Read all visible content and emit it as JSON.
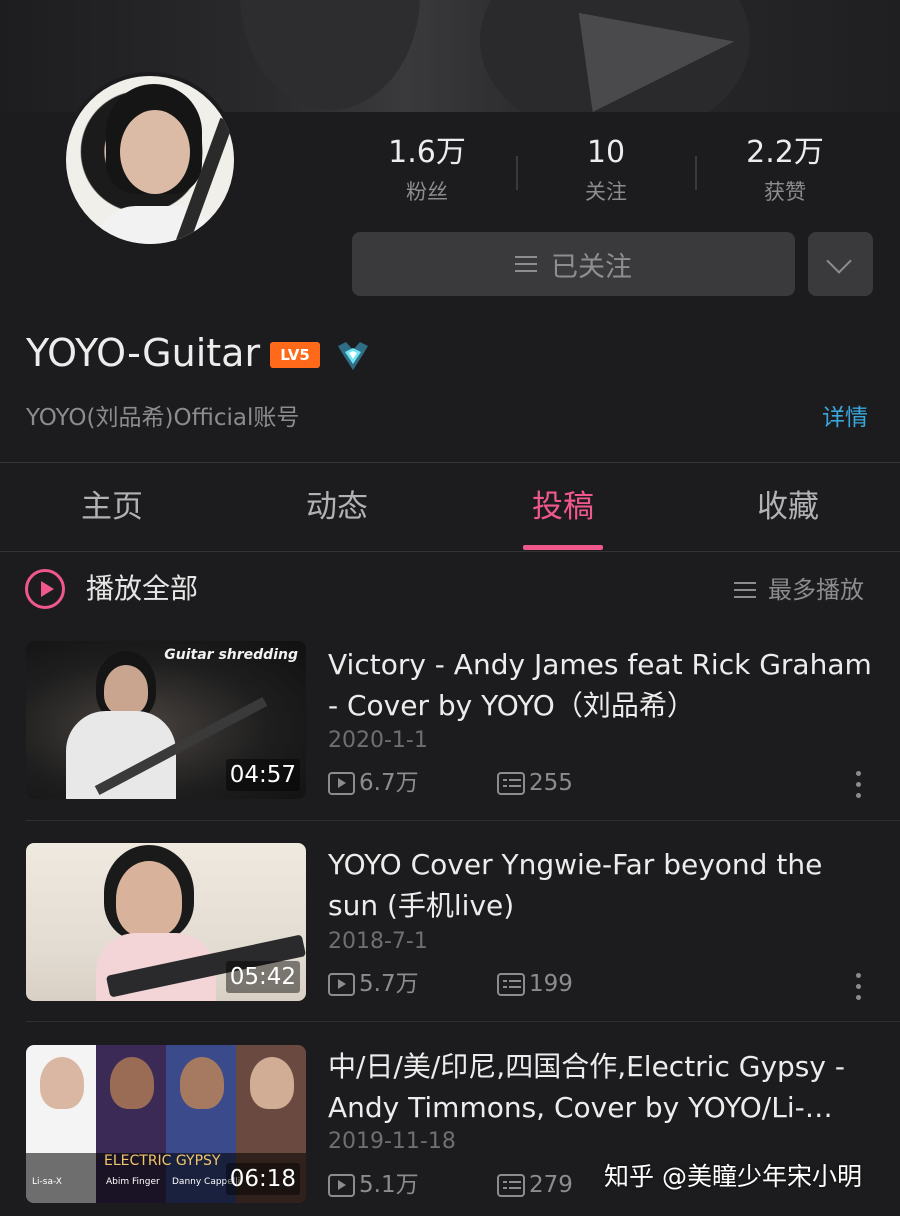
{
  "profile": {
    "name": "YOYO-Guitar",
    "level_badge": "LV5",
    "vip_icon": "vip-diamond-icon",
    "description": "YOYO(刘品希)Official账号",
    "detail_link": "详情"
  },
  "stats": [
    {
      "value": "1.6万",
      "label": "粉丝"
    },
    {
      "value": "10",
      "label": "关注"
    },
    {
      "value": "2.2万",
      "label": "获赞"
    }
  ],
  "follow_button": {
    "label": "已关注"
  },
  "tabs": [
    {
      "label": "主页",
      "active": false
    },
    {
      "label": "动态",
      "active": false
    },
    {
      "label": "投稿",
      "active": true
    },
    {
      "label": "收藏",
      "active": false
    }
  ],
  "list_header": {
    "play_all": "播放全部",
    "sort": "最多播放"
  },
  "videos": [
    {
      "title": "Victory - Andy James feat Rick Graham - Cover by YOYO（刘品希）",
      "date": "2020-1-1",
      "views": "6.7万",
      "comments": "255",
      "duration": "04:57",
      "thumb_caption": "Guitar shredding"
    },
    {
      "title": "YOYO Cover Yngwie-Far beyond the sun (手机live)",
      "date": "2018-7-1",
      "views": "5.7万",
      "comments": "199",
      "duration": "05:42",
      "thumb_caption": ""
    },
    {
      "title": "中/日/美/印尼,四国合作,Electric Gypsy - Andy Timmons, Cover by YOYO/Li-…",
      "date": "2019-11-18",
      "views": "5.1万",
      "comments": "279",
      "duration": "06:18",
      "thumb_caption": "ELECTRIC GYPSY",
      "thumb_names": [
        "Li-sa-X",
        "Abim Finger",
        "Danny Cappelli"
      ]
    }
  ],
  "watermark": "知乎 @美瞳少年宋小明",
  "colors": {
    "accent": "#f0588c",
    "link": "#3aa7dc",
    "background": "#1c1c1e",
    "level_badge": "#ff6a1a"
  }
}
